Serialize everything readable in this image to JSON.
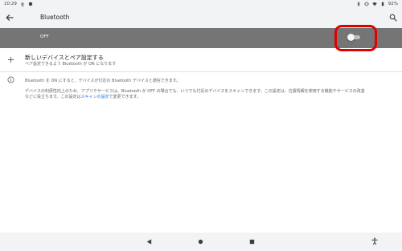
{
  "status_bar": {
    "time": "10:29",
    "battery": "92%",
    "left_icons": [
      "download-icon",
      "shield-icon"
    ],
    "right_icons": [
      "bluetooth-icon",
      "vibrate-icon",
      "wifi-icon",
      "battery-icon"
    ]
  },
  "app_bar": {
    "title": "Bluetooth"
  },
  "master_switch": {
    "label": "OFF",
    "state": "off",
    "highlight_color": "#e00000"
  },
  "pair_device": {
    "title": "新しいデバイスとペア設定する",
    "subtitle": "ペア設定できるよう Bluetooth が ON になります"
  },
  "info": {
    "line1": "Bluetooth を ON にすると、デバイスが付近の Bluetooth デバイスと通信できます。",
    "line2": "デバイスの利便性向上のため、アプリやサービスは、Bluetooth が OFF の場合でも、いつでも付近のデバイスをスキャンできます。この設定は、位置情報を使用する機能やサービスの改善",
    "line3_prefix": "などに役立ちます。この設定は",
    "line3_link": "スキャンの設定",
    "line3_suffix": "で変更できます。"
  },
  "colors": {
    "accent_link": "#1a73e8",
    "master_bar": "#757575",
    "app_bar": "#f1f3f4"
  }
}
